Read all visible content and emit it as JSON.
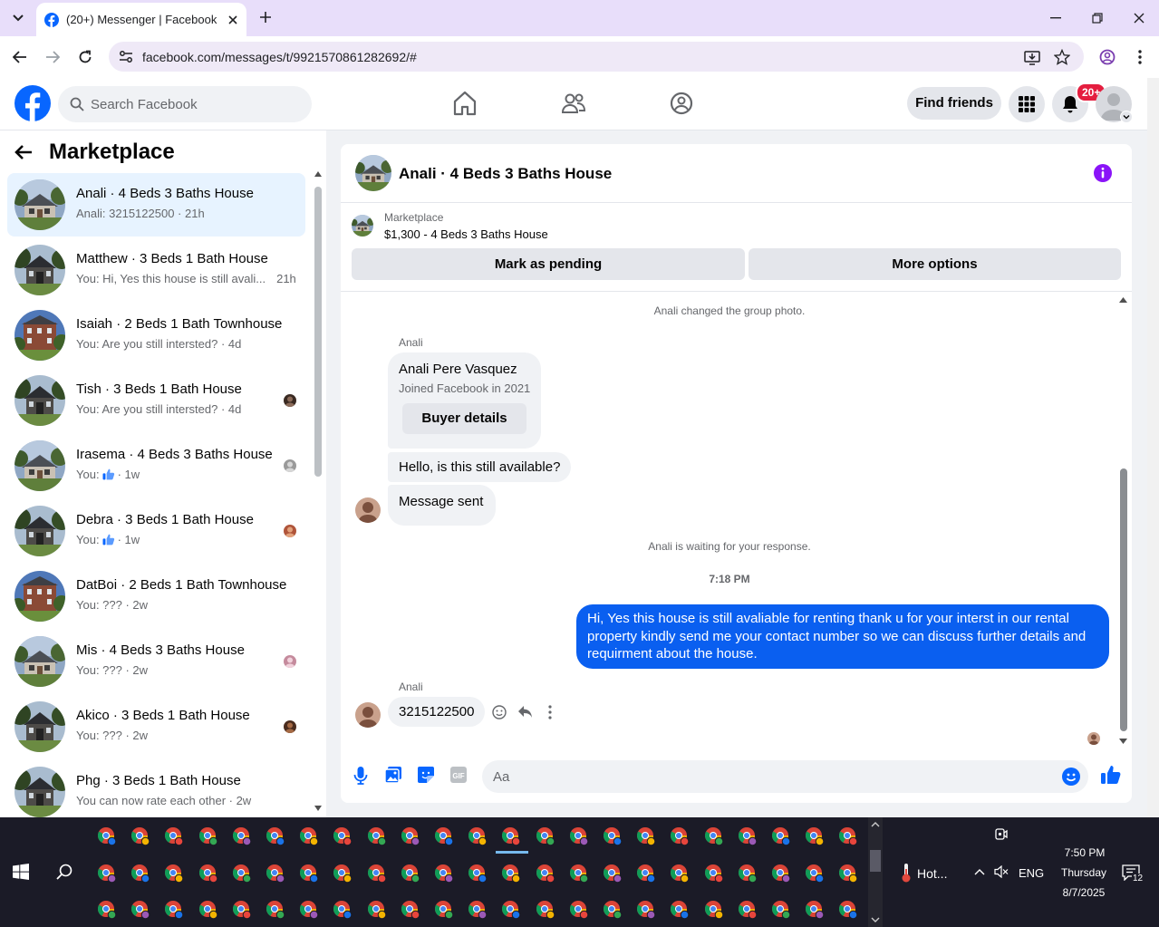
{
  "browser": {
    "tab_title": "(20+) Messenger | Facebook",
    "url": "facebook.com/messages/t/9921570861282692/#"
  },
  "header": {
    "search_placeholder": "Search Facebook",
    "find_friends": "Find friends",
    "notif_badge": "20+",
    "brand_color": "#0866ff"
  },
  "sidebar": {
    "title": "Marketplace",
    "conversations": [
      {
        "name": "Anali · 4 Beds 3 Baths House",
        "preview": "Anali: 3215122500 · 21h",
        "active": true
      },
      {
        "name": "Matthew · 3 Beds 1 Bath House",
        "preview": "You: Hi, Yes this house is still avali...",
        "time": "21h"
      },
      {
        "name": "Isaiah · 2 Beds 1 Bath Townhouse",
        "preview": "You: Are you still intersted? · 4d"
      },
      {
        "name": "Tish · 3 Beds 1 Bath House",
        "preview": "You: Are you still intersted? · 4d"
      },
      {
        "name": "Irasema · 4 Beds 3 Baths House",
        "preview": "You:",
        "time": "· 1w",
        "like": true
      },
      {
        "name": "Debra · 3 Beds 1 Bath House",
        "preview": "You:",
        "time": "· 1w",
        "like": true
      },
      {
        "name": "DatBoi · 2 Beds 1 Bath Townhouse",
        "preview": "You: ??? · 2w"
      },
      {
        "name": "Mis · 4 Beds 3 Baths House",
        "preview": "You: ??? · 2w"
      },
      {
        "name": "Akico · 3 Beds 1 Bath House",
        "preview": "You: ??? · 2w"
      },
      {
        "name": "Phg · 3 Beds 1 Bath House",
        "preview": "You can now rate each other · 2w"
      }
    ]
  },
  "chat": {
    "title": "Anali · 4 Beds 3 Baths House",
    "listing_label": "Marketplace",
    "listing_price": "$1,300 - 4 Beds 3 Baths House",
    "mark_pending": "Mark as pending",
    "more_options": "More options",
    "system_photo": "Anali changed the group photo.",
    "sender_name": "Anali",
    "buyer_name": "Anali Pere Vasquez",
    "buyer_joined": "Joined Facebook in 2021",
    "buyer_details": "Buyer details",
    "msg_available": "Hello, is this still available?",
    "msg_sent": "Message sent",
    "waiting": "Anali is waiting for your response.",
    "time": "7:18 PM",
    "outgoing": "Hi, Yes this house is still avaliable for renting thank u for your interst in our rental property kindly send me your contact number so we can discuss further details and requirment about the house.",
    "reply": "3215122500",
    "input_placeholder": "Aa",
    "accent_color": "#0a5ff0"
  },
  "taskbar": {
    "weather": "Hot...",
    "lang": "ENG",
    "time": "7:50 PM",
    "day": "Thursday",
    "date": "8/7/2025",
    "notif_count": "12"
  }
}
